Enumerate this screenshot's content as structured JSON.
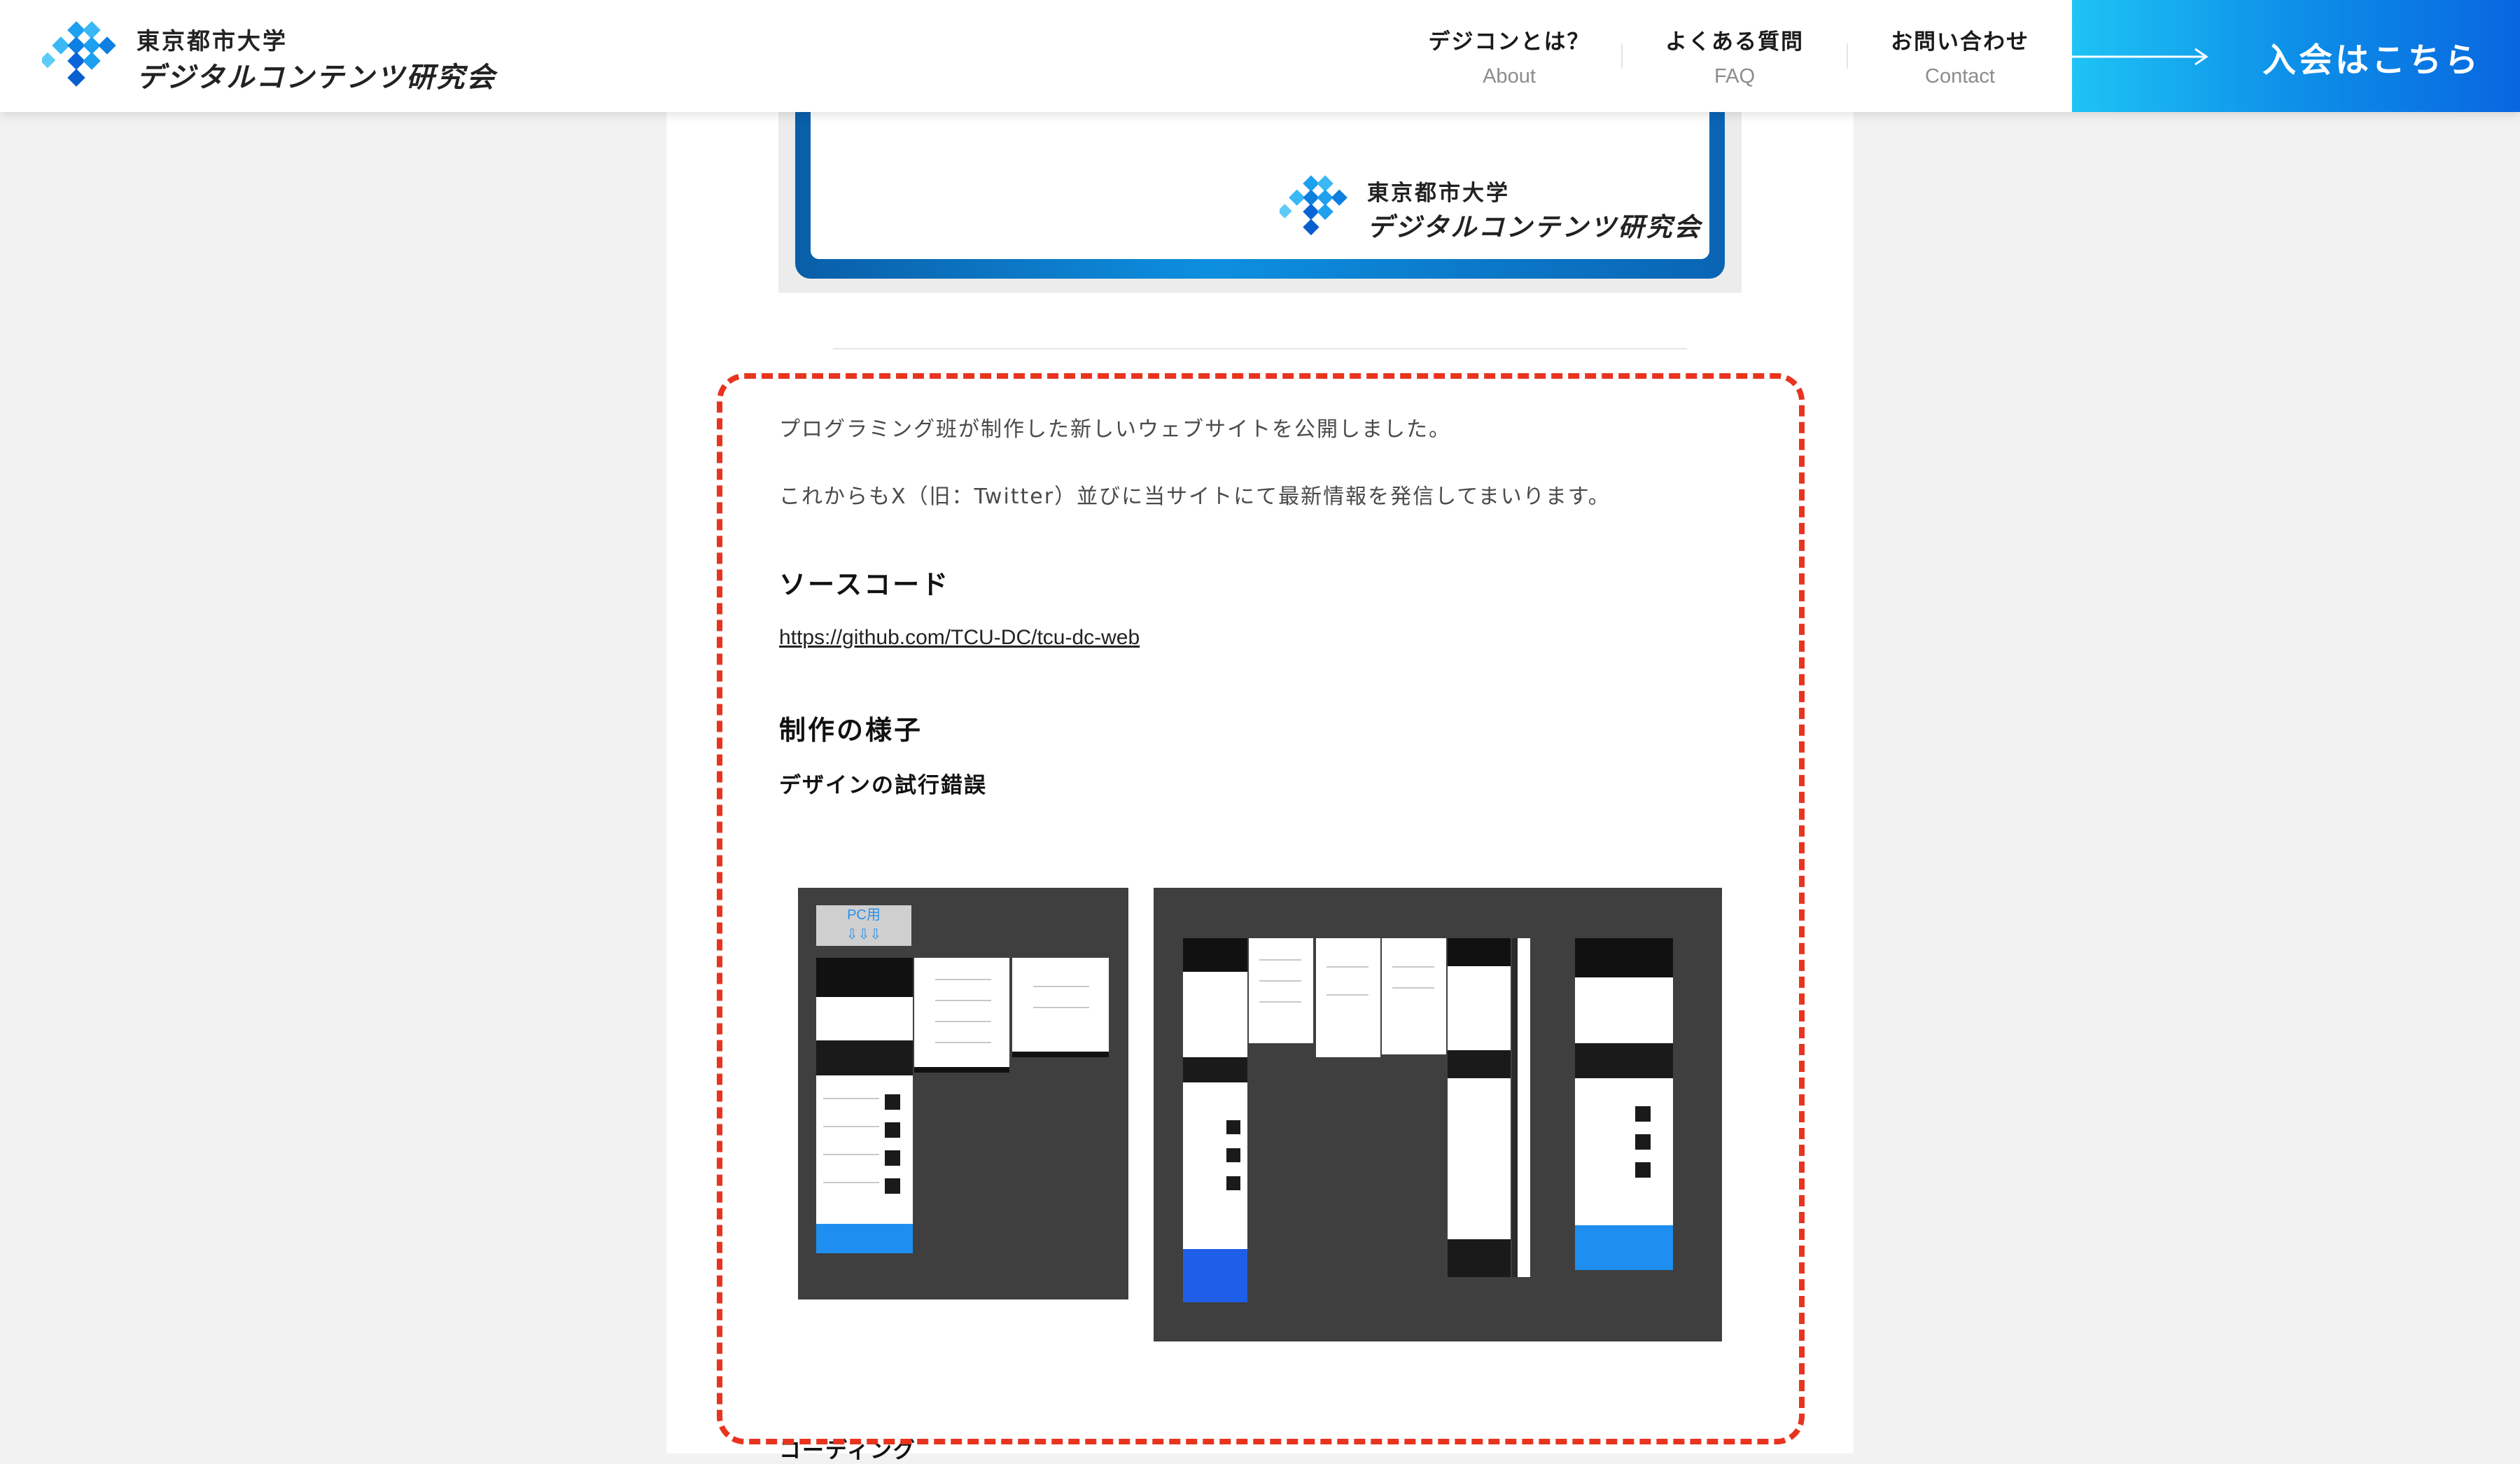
{
  "header": {
    "logo_line1": "東京都市大学",
    "logo_line2": "デジタルコンテンツ研究会",
    "nav": [
      {
        "jp": "デジコンとは？",
        "en": "About"
      },
      {
        "jp": "よくある質問",
        "en": "FAQ"
      },
      {
        "jp": "お問い合わせ",
        "en": "Contact"
      }
    ],
    "join_label": "入会はこちら"
  },
  "hero": {
    "logo_line1": "東京都市大学",
    "logo_line2": "デジタルコンテンツ研究会"
  },
  "article": {
    "para1": "プログラミング班が制作した新しいウェブサイトを公開しました。",
    "para2": "これからもX（旧：Twitter）並びに当サイトにて最新情報を発信してまいります。",
    "heading_source": "ソースコード",
    "source_link": "https://github.com/TCU-DC/tcu-dc-web",
    "heading_making": "制作の様子",
    "subheading_design": "デザインの試行錯誤",
    "pc_label": "PC用",
    "pc_arrows": "⇩⇩⇩",
    "cut_heading": "コーディング"
  },
  "colors": {
    "accent_blue": "#0d8fe8",
    "dashed_red": "#e8341f"
  }
}
